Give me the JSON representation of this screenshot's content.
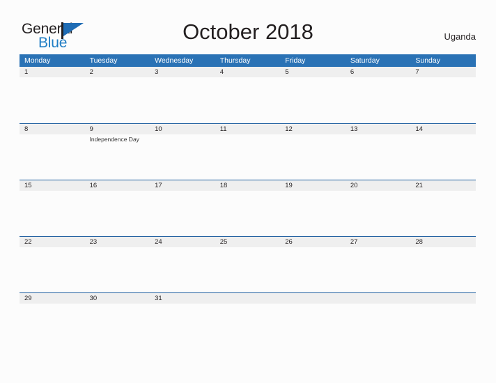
{
  "brand": {
    "name_part1": "General",
    "name_part2": "Blue",
    "flag_icon": "flag-icon",
    "accent_color": "#1f7dc4"
  },
  "header": {
    "title": "October 2018",
    "country": "Uganda"
  },
  "colors": {
    "header_blue": "#2a72b5",
    "row_divider_blue": "#1f5fa0",
    "band_gray": "#efefef",
    "page_background": "#fcfcfc",
    "text": "#231f20"
  },
  "calendar": {
    "weekdays": [
      "Monday",
      "Tuesday",
      "Wednesday",
      "Thursday",
      "Friday",
      "Saturday",
      "Sunday"
    ],
    "weeks": [
      [
        {
          "day": "1",
          "event": ""
        },
        {
          "day": "2",
          "event": ""
        },
        {
          "day": "3",
          "event": ""
        },
        {
          "day": "4",
          "event": ""
        },
        {
          "day": "5",
          "event": ""
        },
        {
          "day": "6",
          "event": ""
        },
        {
          "day": "7",
          "event": ""
        }
      ],
      [
        {
          "day": "8",
          "event": ""
        },
        {
          "day": "9",
          "event": "Independence Day"
        },
        {
          "day": "10",
          "event": ""
        },
        {
          "day": "11",
          "event": ""
        },
        {
          "day": "12",
          "event": ""
        },
        {
          "day": "13",
          "event": ""
        },
        {
          "day": "14",
          "event": ""
        }
      ],
      [
        {
          "day": "15",
          "event": ""
        },
        {
          "day": "16",
          "event": ""
        },
        {
          "day": "17",
          "event": ""
        },
        {
          "day": "18",
          "event": ""
        },
        {
          "day": "19",
          "event": ""
        },
        {
          "day": "20",
          "event": ""
        },
        {
          "day": "21",
          "event": ""
        }
      ],
      [
        {
          "day": "22",
          "event": ""
        },
        {
          "day": "23",
          "event": ""
        },
        {
          "day": "24",
          "event": ""
        },
        {
          "day": "25",
          "event": ""
        },
        {
          "day": "26",
          "event": ""
        },
        {
          "day": "27",
          "event": ""
        },
        {
          "day": "28",
          "event": ""
        }
      ],
      [
        {
          "day": "29",
          "event": ""
        },
        {
          "day": "30",
          "event": ""
        },
        {
          "day": "31",
          "event": ""
        },
        {
          "day": "",
          "event": ""
        },
        {
          "day": "",
          "event": ""
        },
        {
          "day": "",
          "event": ""
        },
        {
          "day": "",
          "event": ""
        }
      ]
    ]
  }
}
